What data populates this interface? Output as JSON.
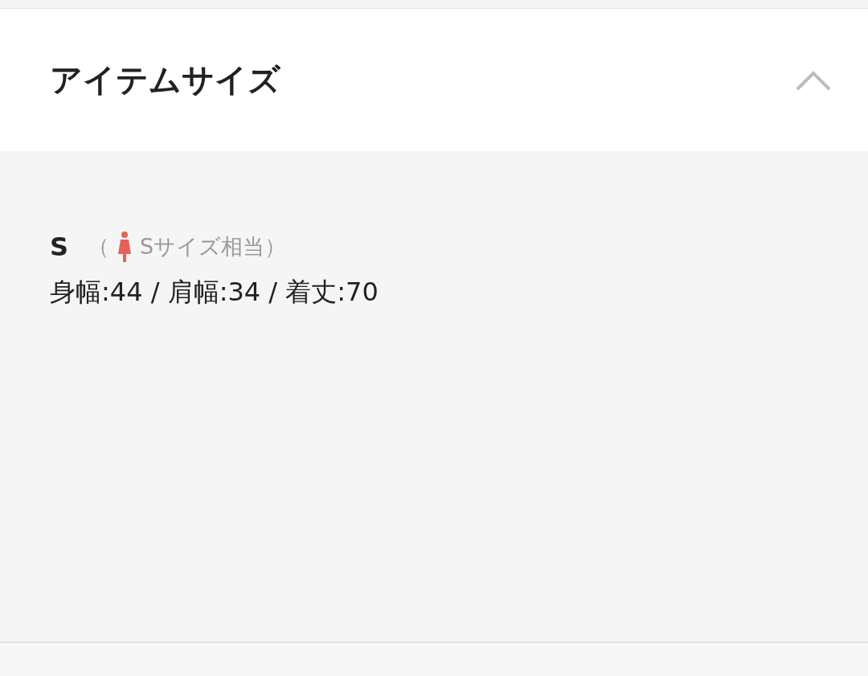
{
  "section": {
    "title": "アイテムサイズ",
    "expanded": true
  },
  "sizes": [
    {
      "size": "S",
      "open_paren": "（",
      "equivalent": "Sサイズ相当）",
      "color": "#e8605a",
      "measurements": "身幅:44 / 肩幅:34 / 着丈:70"
    }
  ]
}
